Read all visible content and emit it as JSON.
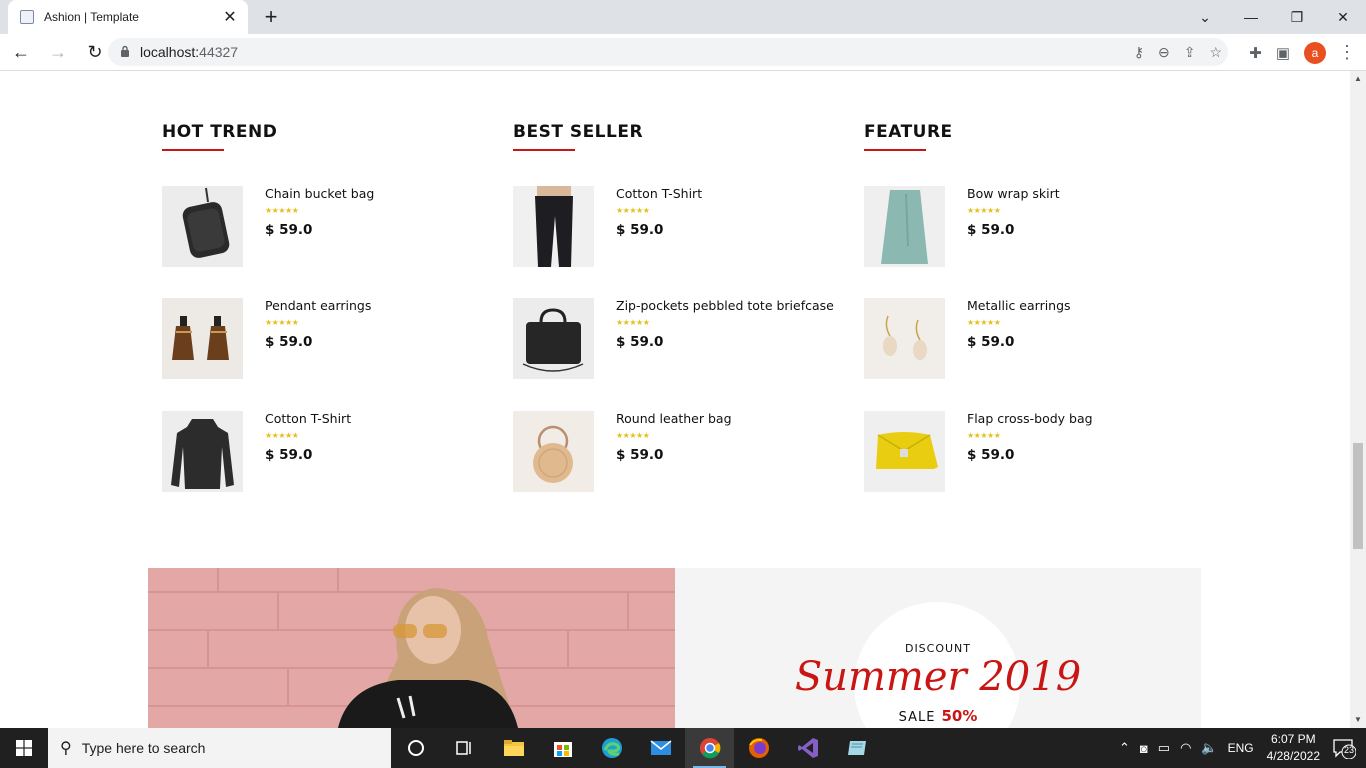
{
  "browser": {
    "tab_title": "Ashion | Template",
    "url_host": "localhost:",
    "url_port": "44327",
    "avatar_letter": "a"
  },
  "columns": [
    {
      "title": "HOT TREND",
      "items": [
        {
          "name": "Chain bucket bag",
          "stars": "★★★★★",
          "price": "$ 59.0",
          "thumb": "bag-icon"
        },
        {
          "name": "Pendant earrings",
          "stars": "★★★★★",
          "price": "$ 59.0",
          "thumb": "earrings-icon"
        },
        {
          "name": "Cotton T-Shirt",
          "stars": "★★★★★",
          "price": "$ 59.0",
          "thumb": "sweater-icon"
        }
      ]
    },
    {
      "title": "BEST SELLER",
      "items": [
        {
          "name": "Cotton T-Shirt",
          "stars": "★★★★★",
          "price": "$ 59.0",
          "thumb": "jeans-icon"
        },
        {
          "name": "Zip-pockets pebbled tote briefcase",
          "stars": "★★★★★",
          "price": "$ 59.0",
          "thumb": "briefcase-icon"
        },
        {
          "name": "Round leather bag",
          "stars": "★★★★★",
          "price": "$ 59.0",
          "thumb": "round-bag-icon"
        }
      ]
    },
    {
      "title": "FEATURE",
      "items": [
        {
          "name": "Bow wrap skirt",
          "stars": "★★★★★",
          "price": "$ 59.0",
          "thumb": "skirt-icon"
        },
        {
          "name": "Metallic earrings",
          "stars": "★★★★★",
          "price": "$ 59.0",
          "thumb": "shell-earrings-icon"
        },
        {
          "name": "Flap cross-body bag",
          "stars": "★★★★★",
          "price": "$ 59.0",
          "thumb": "yellow-bag-icon"
        }
      ]
    }
  ],
  "discount": {
    "label": "DISCOUNT",
    "title": "Summer 2019",
    "sale_label": "SALE",
    "sale_pct": "50%"
  },
  "taskbar": {
    "search_placeholder": "Type here to search",
    "lang": "ENG",
    "time": "6:07 PM",
    "date": "4/28/2022",
    "notif_count": "23"
  },
  "colors": {
    "accent": "#ca1515",
    "stars": "#e3c01c"
  }
}
